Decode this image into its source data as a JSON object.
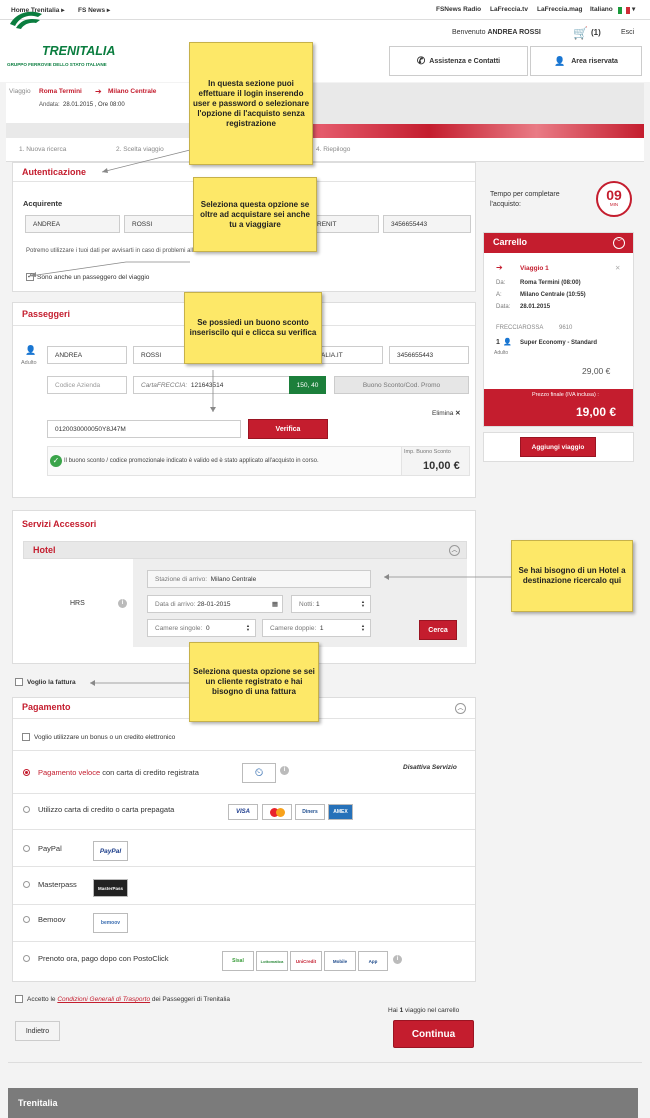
{
  "topbar": {
    "home": "Home Trenitalia ▸",
    "news": "FS News ▸",
    "radio": "FSNews Radio",
    "tv": "LaFreccia.tv",
    "mag": "LaFreccia.mag",
    "lang": "Italiano"
  },
  "header": {
    "logo": "TRENITALIA",
    "logo_sub": "GRUPPO FERROVIE DELLO STATO ITALIANE",
    "welcome_prefix": "Benvenuto",
    "user": "ANDREA ROSSI",
    "cart_count": "(1)",
    "exit": "Esci",
    "assist": "Assistenza e Contatti",
    "reserved": "Area riservata"
  },
  "trip": {
    "label": "Viaggio",
    "from": "Roma Termini",
    "to": "Milano Centrale",
    "date_label": "Andata:",
    "date": "28.01.2015 , Ore 08:00"
  },
  "steps": [
    "1. Nuova ricerca",
    "2. Scelta viaggio",
    "4. Riepilogo"
  ],
  "auth": {
    "title": "Autenticazione",
    "buyer": "Acquirente",
    "name": "ANDREA",
    "surname": "ROSSI",
    "email_part": "RENIT",
    "phone": "3456655443",
    "privacy": "Potremo utilizzare i tuoi dati per avvisarti in caso di problemi alla circolazione dei treni.",
    "also_passenger": "Sono anche un passeggero del viaggio"
  },
  "passengers": {
    "title": "Passeggeri",
    "adult": "Adulto",
    "name": "ANDREA",
    "surname": "ROSSI",
    "email_part": "NITALIA.IT",
    "phone": "3456655443",
    "company_ph": "Codice Azienda",
    "card_label": "CartaFRECCIA:",
    "card_num": "121643514",
    "points": "150, 40",
    "promo_btn": "Buono Sconto/Cod. Promo",
    "remove": "Elimina",
    "code": "0120030000050Y8J47M",
    "verify": "Verifica",
    "success": "Il buono sconto / codice promozionale indicato è valido ed è stato applicato all'acquisto in corso.",
    "imp_label": "Imp. Buono Sconto",
    "imp_value": "10,00 €"
  },
  "services": {
    "title": "Servizi Accessori",
    "hotel": "Hotel",
    "hrs": "HRS",
    "station_label": "Stazione di arrivo:",
    "station": "Milano Centrale",
    "date_label": "Data di arrivo:",
    "date": "28-01-2015",
    "nights_label": "Notti:",
    "nights": "1",
    "single_label": "Camere singole:",
    "single": "0",
    "double_label": "Camere doppie:",
    "double": "1",
    "search": "Cerca"
  },
  "invoice": "Voglio la fattura",
  "payment": {
    "title": "Pagamento",
    "bonus": "Voglio utilizzare un bonus o un credito elettronico",
    "fast_red": "Pagamento veloce",
    "fast_rest": "con carta di credito registrata",
    "disable": "Disattiva Servizio",
    "card": "Utilizzo carta di credito o carta prepagata",
    "paypal": "PayPal",
    "masterpass": "Masterpass",
    "bemoov": "Bemoov",
    "posto": "Prenoto ora, pago dopo con PostoClick",
    "logos": {
      "visa": "VISA",
      "mc": "MC",
      "diners": "Diners",
      "amex": "AMEX",
      "pp": "PayPal",
      "mp": "MasterPass",
      "bm": "bemoov",
      "sisal": "Sisal",
      "lottomatica": "Lottomatica",
      "unicredit": "UniCredit",
      "mobile": "Mobile",
      "app": "App"
    }
  },
  "terms": {
    "prefix": "Accetto le",
    "link": "Condizioni Generali di Trasporto",
    "suffix": "dei Passeggeri di Trenitalia"
  },
  "cart_note_prefix": "Hai",
  "cart_note_num": "1",
  "cart_note_suffix": "viaggio nel carrello",
  "back": "Indietro",
  "continue": "Continua",
  "timer": {
    "label": "Tempo per completare l'acquisto:",
    "value": "09",
    "unit": "MIN"
  },
  "cart": {
    "title": "Carrello",
    "trip": "Viaggio 1",
    "da_label": "Da:",
    "da": "Roma Termini (08:00)",
    "a_label": "A:",
    "a": "Milano Centrale (10:55)",
    "date_label": "Data:",
    "date": "28.01.2015",
    "train": "FRECCIAROSSA",
    "train_no": "9610",
    "qty": "1",
    "adult": "Adulto",
    "fare": "Super Economy - Standard",
    "price": "29,00 €",
    "final_label": "Prezzo finale (IVA inclusa) :",
    "final": "19,00 €",
    "add": "Aggiungi viaggio"
  },
  "notes": {
    "n1": "In questa sezione puoi effettuare il login inserendo user e password o selezionare l'opzione di l'acquisto senza registrazione",
    "n2": "Seleziona questa opzione se oltre ad acquistare sei anche tu a viaggiare",
    "n3": "Se possiedi un buono sconto inseriscilo qui e clicca su verifica",
    "n4": "Se hai bisogno di un Hotel a destinazione ricercalo qui",
    "n5": "Seleziona questa opzione se sei un cliente registrato e hai bisogno di una fattura"
  },
  "footer": "Trenitalia"
}
